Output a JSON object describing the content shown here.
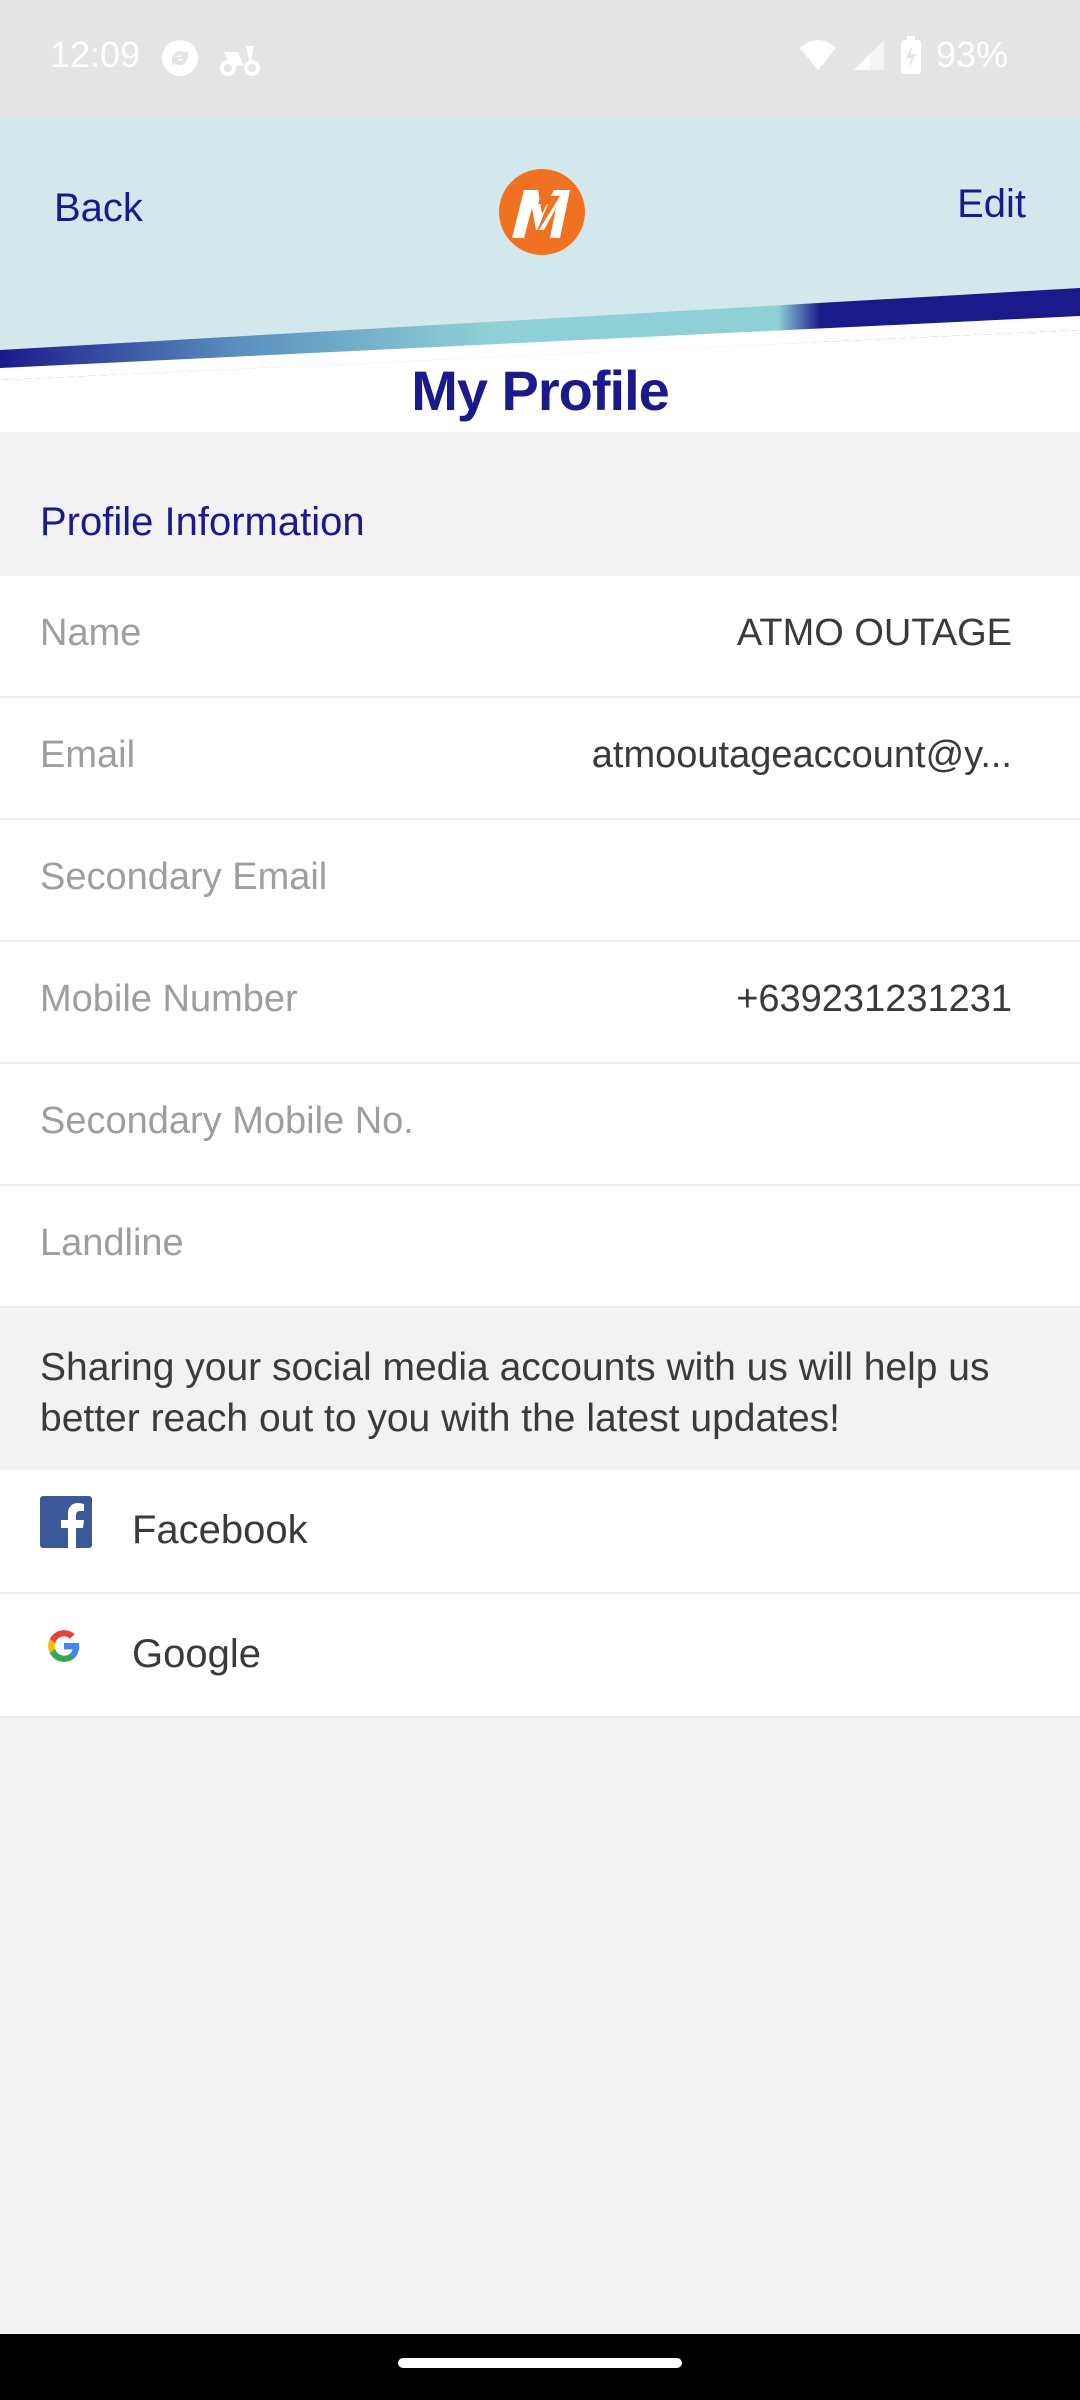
{
  "status_bar": {
    "time": "12:09",
    "battery": "93%",
    "icons": [
      "sync-icon",
      "scooter-icon",
      "wifi-icon",
      "signal-icon",
      "battery-icon"
    ]
  },
  "header": {
    "back_label": "Back",
    "edit_label": "Edit",
    "title": "My Profile",
    "logo": "meralco-logo",
    "colors": {
      "title": "#1b1a8a",
      "logo": "#f07122",
      "band": "#d3e8ec"
    }
  },
  "profile": {
    "section_title": "Profile Information",
    "fields": [
      {
        "label": "Name",
        "value": "ATMO OUTAGE"
      },
      {
        "label": "Email",
        "value": "atmooutageaccount@y..."
      },
      {
        "label": "Secondary Email",
        "value": ""
      },
      {
        "label": "Mobile Number",
        "value": "+639231231231"
      },
      {
        "label": "Secondary Mobile No.",
        "value": ""
      },
      {
        "label": "Landline",
        "value": ""
      }
    ]
  },
  "social": {
    "message": "Sharing your social media accounts with us will help us better reach out to you with the latest updates!",
    "accounts": [
      {
        "label": "Facebook",
        "icon": "facebook-icon"
      },
      {
        "label": "Google",
        "icon": "google-icon"
      }
    ]
  }
}
